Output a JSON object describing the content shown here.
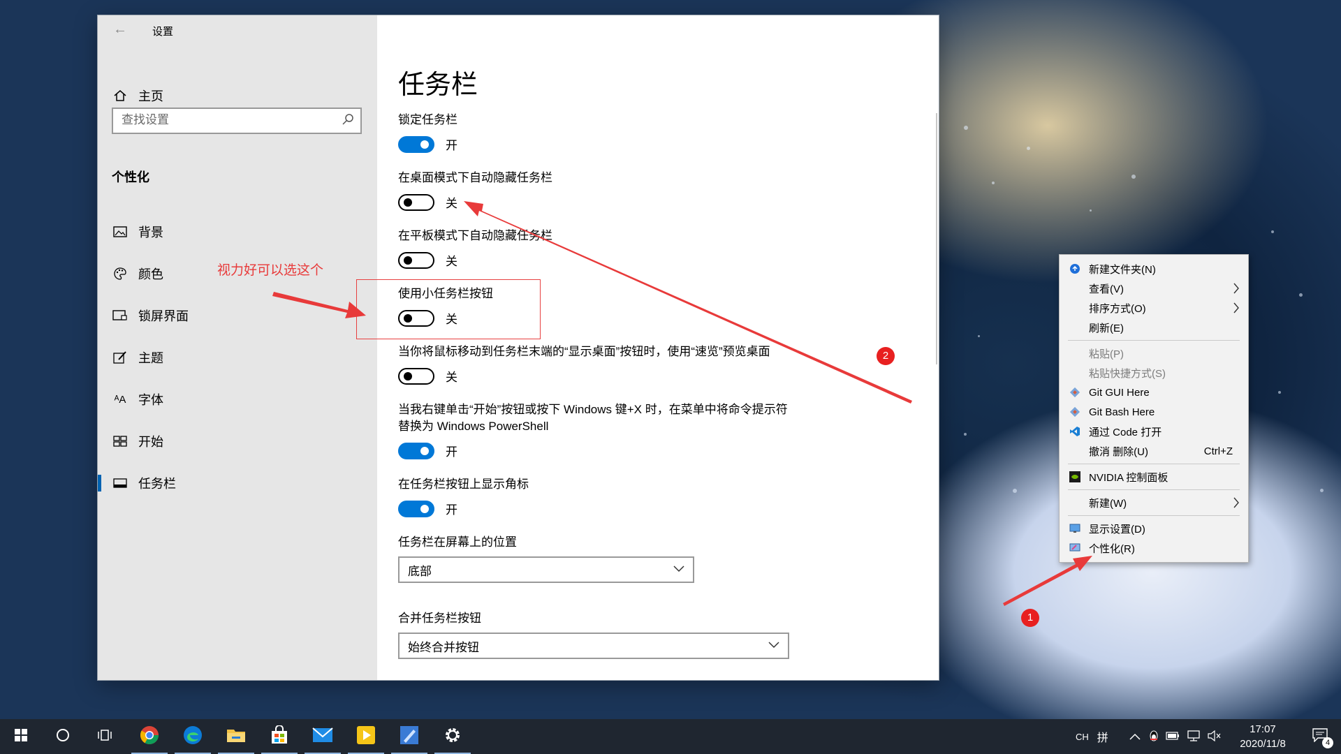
{
  "window": {
    "title": "设置",
    "back_label": "←",
    "minimize": "—",
    "maximize": "☐",
    "close": "✕"
  },
  "sidebar": {
    "home_label": "主页",
    "search_placeholder": "查找设置",
    "section_heading": "个性化",
    "items": [
      {
        "label": "背景",
        "icon": "image-icon"
      },
      {
        "label": "颜色",
        "icon": "palette-icon"
      },
      {
        "label": "锁屏界面",
        "icon": "lock-screen-icon"
      },
      {
        "label": "主题",
        "icon": "theme-brush-icon"
      },
      {
        "label": "字体",
        "icon": "font-icon"
      },
      {
        "label": "开始",
        "icon": "start-grid-icon"
      },
      {
        "label": "任务栏",
        "icon": "taskbar-icon",
        "active": true
      }
    ]
  },
  "main": {
    "title": "任务栏",
    "settings": [
      {
        "label": "锁定任务栏",
        "state": "on",
        "state_label": "开"
      },
      {
        "label": "在桌面模式下自动隐藏任务栏",
        "state": "off",
        "state_label": "关"
      },
      {
        "label": "在平板模式下自动隐藏任务栏",
        "state": "off",
        "state_label": "关"
      },
      {
        "label": "使用小任务栏按钮",
        "state": "off",
        "state_label": "关"
      },
      {
        "label": "当你将鼠标移动到任务栏末端的“显示桌面”按钮时，使用“速览”预览桌面",
        "state": "off",
        "state_label": "关"
      },
      {
        "label": "当我右键单击“开始”按钮或按下 Windows 键+X 时，在菜单中将命令提示符替换为 Windows PowerShell",
        "state": "on",
        "state_label": "开"
      },
      {
        "label": "在任务栏按钮上显示角标",
        "state": "on",
        "state_label": "开"
      }
    ],
    "position_label": "任务栏在屏幕上的位置",
    "position_value": "底部",
    "combine_label": "合并任务栏按钮",
    "combine_value": "始终合并按钮"
  },
  "annotations": {
    "hint_text": "视力好可以选这个",
    "badge_1": "1",
    "badge_2": "2",
    "color": "#e83a3a"
  },
  "context_menu": {
    "items": [
      {
        "label": "新建文件夹(N)",
        "icon": "new-folder-icon"
      },
      {
        "label": "查看(V)",
        "submenu": true
      },
      {
        "label": "排序方式(O)",
        "submenu": true
      },
      {
        "label": "刷新(E)"
      },
      {
        "label": "粘贴(P)",
        "disabled": true
      },
      {
        "label": "粘贴快捷方式(S)",
        "disabled": true
      },
      {
        "label": "Git GUI Here",
        "icon": "git-icon"
      },
      {
        "label": "Git Bash Here",
        "icon": "git-icon"
      },
      {
        "label": "通过 Code 打开",
        "icon": "vscode-icon"
      },
      {
        "label": "撤消 删除(U)",
        "shortcut": "Ctrl+Z"
      },
      {
        "label": "NVIDIA 控制面板",
        "icon": "nvidia-icon"
      },
      {
        "label": "新建(W)",
        "submenu": true
      },
      {
        "label": "显示设置(D)",
        "icon": "display-icon"
      },
      {
        "label": "个性化(R)",
        "icon": "personalize-icon"
      }
    ]
  },
  "taskbar": {
    "pinned": [
      "start-icon",
      "cortana-icon",
      "task-view-icon",
      "chrome-icon",
      "edge-icon",
      "file-explorer-icon",
      "store-icon",
      "mail-icon",
      "potplayer-icon",
      "paint-icon",
      "settings-gear-icon"
    ],
    "ime_label": "CH",
    "ime_mode": "拼",
    "time": "17:07",
    "date": "2020/11/8",
    "notification_count": "4",
    "accent": "#0078d7"
  }
}
